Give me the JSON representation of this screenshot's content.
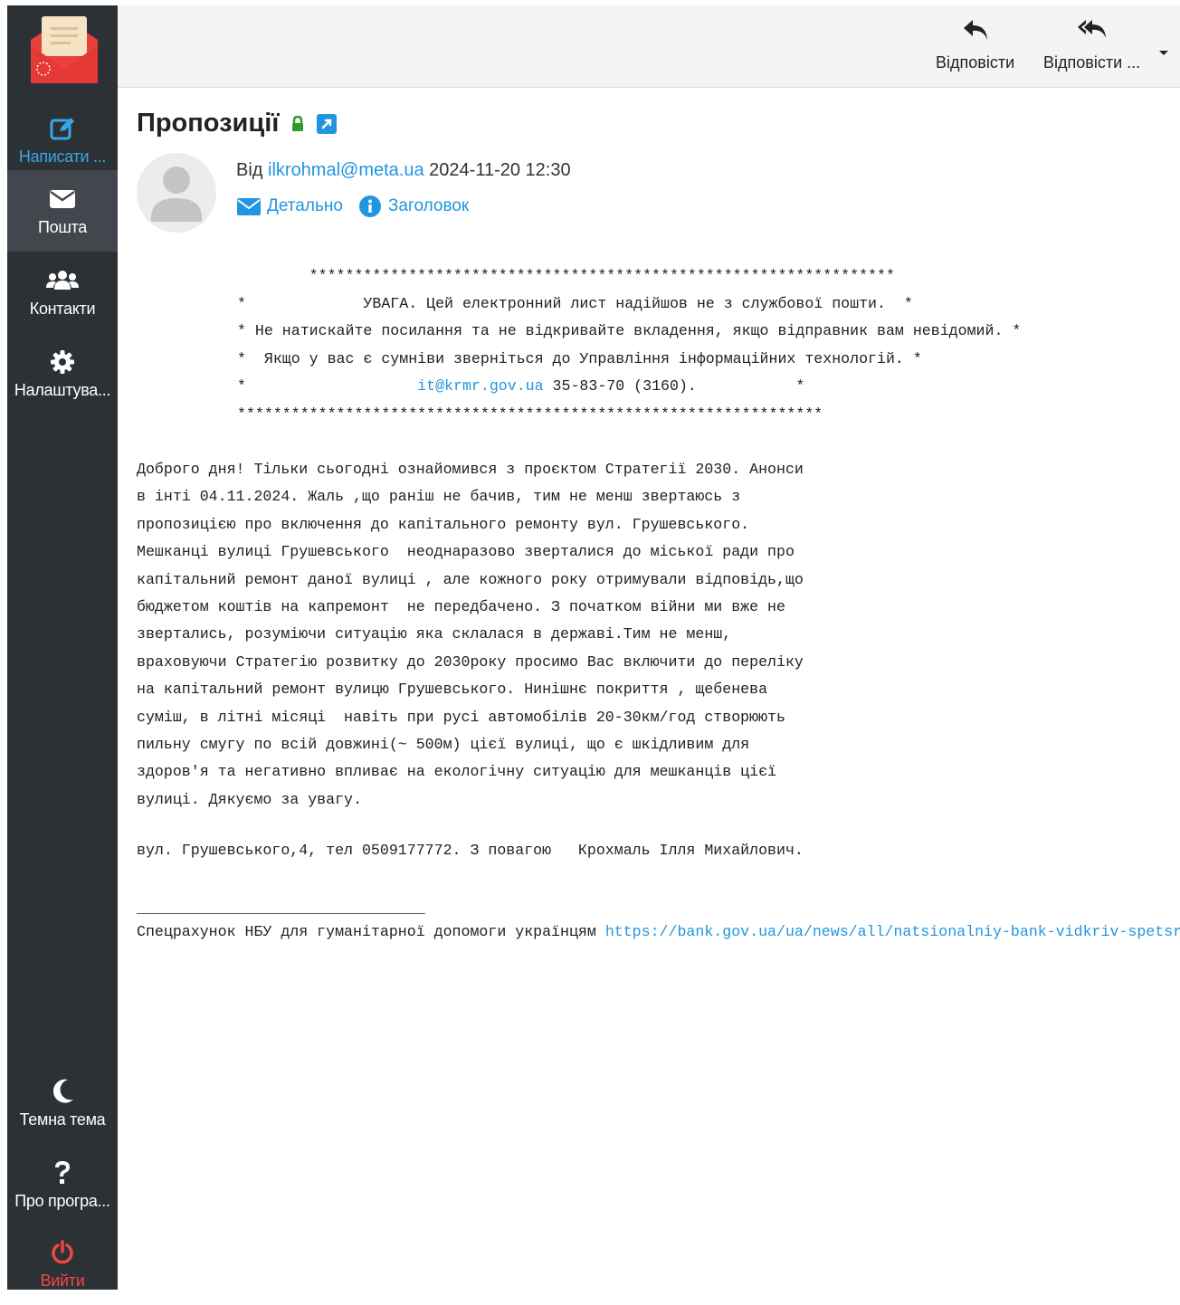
{
  "sidebar": {
    "compose_label": "Написати ...",
    "mail_label": "Пошта",
    "contacts_label": "Контакти",
    "settings_label": "Налаштува...",
    "theme_label": "Темна тема",
    "about_label": "Про програ...",
    "logout_label": "Вийти"
  },
  "toolbar": {
    "reply_label": "Відповісти",
    "reply_all_label": "Відповісти ..."
  },
  "message": {
    "subject": "Пропозиції",
    "from_prefix": "Від",
    "from_email": "ilkrohmal@meta.ua",
    "date": "2024-11-20 12:30",
    "details_label": "Детально",
    "headers_label": "Заголовок"
  },
  "warning": {
    "line1": "        *****************************************************************",
    "line2": "*             УВАГА. Цей електронний лист надійшов не з службової пошти.  *",
    "line3": "* Не натискайте посилання та не відкривайте вкладення, якщо відправник вам невідомий. *",
    "line4": "*  Якщо у вас є сумніви зверніться до Управління інформаційних технологій. *",
    "line5_pre": "*                   ",
    "line5_link": "it@krmr.gov.ua",
    "line5_post": " 35-83-70 (3160).           *",
    "line6": "*****************************************************************"
  },
  "body": {
    "text": "Доброго дня! Тільки сьогодні ознайомився з проєктом Стратегії 2030. Анонси\nв інті 04.11.2024. Жаль ,що раніш не бачив, тим не менш звертаюсь з\nпропозицією про включення до капітального ремонту вул. Грушевського.\nМешканці вулиці Грушевського  неоднаразово зверталися до міської ради про\nкапітальний ремонт даної вулиці , але кожного року отримували відповідь,що\nбюджетом коштів на капремонт  не передбачено. З початком війни ми вже не\nзвертались, розуміючи ситуацію яка склалася в державі.Тим не менш,\nвраховуючи Стратегію розвитку до 2030року просимо Вас включити до переліку\nна капітальний ремонт вулицю Грушевського. Нинішнє покриття , щебенева\nсуміш, в літні місяці  навіть при русі автомобілів 20-30км/год створюють\nпильну смугу по всій довжині(~ 500м) цієї вулиці, що є шкідливим для\nздоров'я та негативно впливає на екологічну ситуацію для мешканців цієї\nвулиці. Дякуємо за увагу.",
    "signature": "вул. Грушевського,4, тел 0509177772. З повагою   Крохмаль Ілля Михайлович.",
    "separator": "________________________________",
    "footer_text": "Спецрахунок НБУ для гуманітарної допомоги українцям ",
    "footer_link": "https://bank.gov.ua/ua/news/all/natsionalniy-bank-vidkriv-spetsrahunok"
  },
  "colors": {
    "sidebar_bg": "#2c3136",
    "accent": "#2196e0",
    "logout": "#f04646",
    "lock": "#2e9b2e"
  }
}
